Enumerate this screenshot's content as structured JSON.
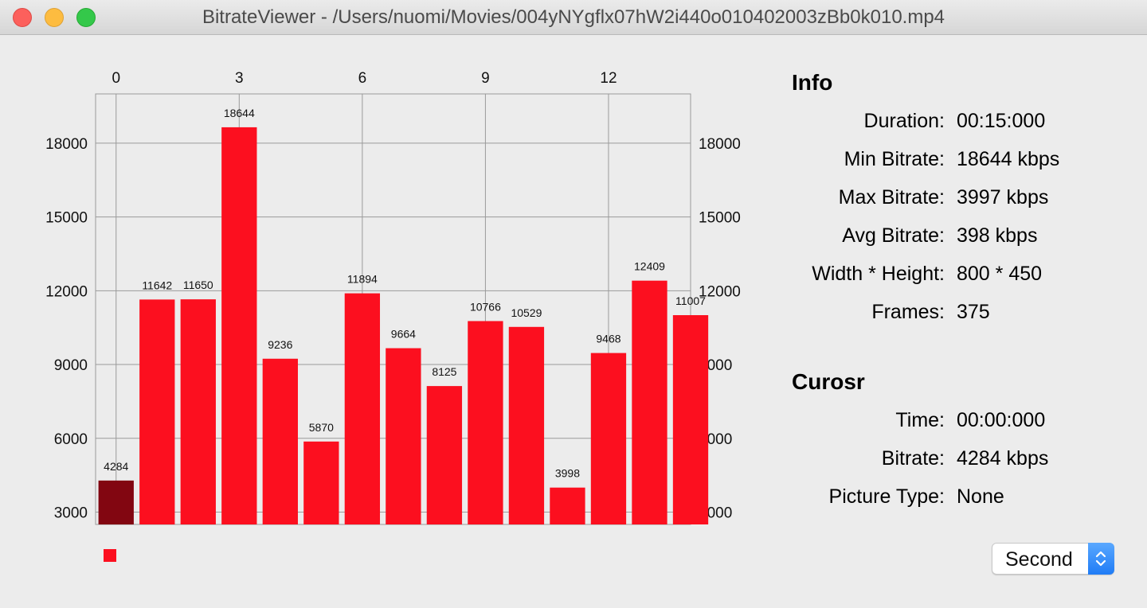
{
  "window": {
    "title": "BitrateViewer - /Users/nuomi/Movies/004yNYgflx07hW2i440o010402003zBb0k010.mp4"
  },
  "info": {
    "heading": "Info",
    "rows": [
      {
        "label": "Duration:",
        "value": "00:15:000"
      },
      {
        "label": "Min Bitrate:",
        "value": "18644 kbps"
      },
      {
        "label": "Max Bitrate:",
        "value": "3997 kbps"
      },
      {
        "label": "Avg Bitrate:",
        "value": "398 kbps"
      },
      {
        "label": "Width * Height:",
        "value": "800 * 450"
      },
      {
        "label": "Frames:",
        "value": "375"
      }
    ]
  },
  "cursor": {
    "heading": "Curosr",
    "rows": [
      {
        "label": "Time:",
        "value": "00:00:000"
      },
      {
        "label": "Bitrate:",
        "value": "4284 kbps"
      },
      {
        "label": "Picture Type:",
        "value": "None"
      }
    ]
  },
  "unit_select": {
    "value": "Second"
  },
  "colors": {
    "bar": "#fc0f1f",
    "bar_selected": "#820611",
    "grid": "#9a9a9a"
  },
  "chart_data": {
    "type": "bar",
    "x": [
      0,
      1,
      2,
      3,
      4,
      5,
      6,
      7,
      8,
      9,
      10,
      11,
      12,
      13,
      14
    ],
    "values": [
      4284,
      11642,
      11650,
      18644,
      9236,
      5870,
      11894,
      9664,
      8125,
      10766,
      10529,
      3998,
      9468,
      12409,
      11007
    ],
    "selected_index": 0,
    "x_ticks": [
      0,
      3,
      6,
      9,
      12
    ],
    "y_ticks": [
      3000,
      6000,
      9000,
      12000,
      15000,
      18000
    ],
    "xlim": [
      0,
      14.5
    ],
    "ylim": [
      2500,
      20000
    ],
    "x_axis_position": "top",
    "y_axis_position": "both",
    "grid": true,
    "legend": "bottom-left"
  }
}
